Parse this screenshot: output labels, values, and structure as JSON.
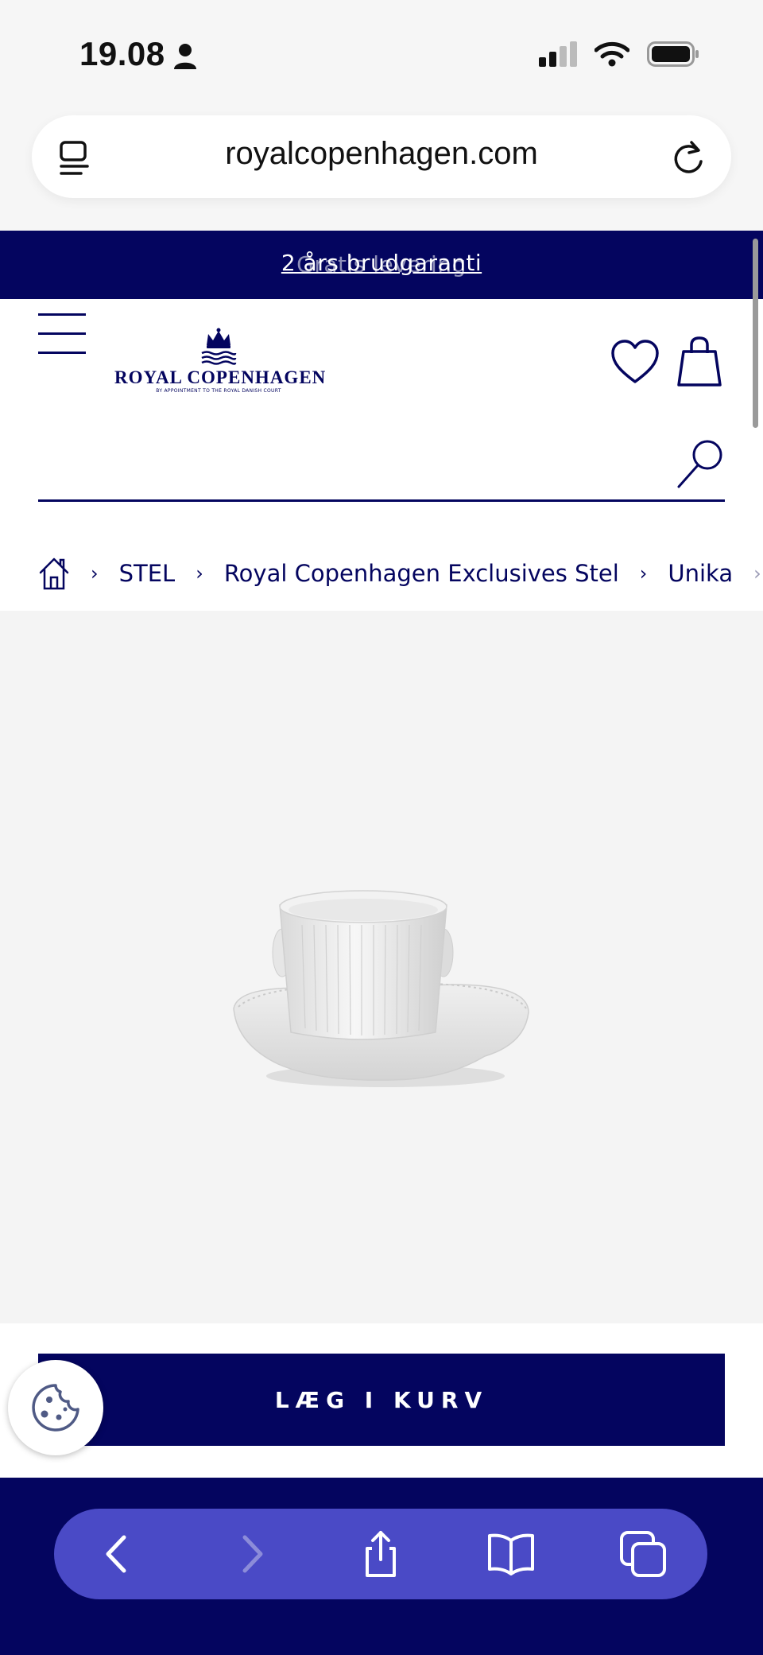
{
  "status_bar": {
    "time": "19.08"
  },
  "browser": {
    "url": "royalcopenhagen.com"
  },
  "promo": {
    "ghost_text": "Gratis levering",
    "text": "2 års brudgaranti"
  },
  "header": {
    "logo_name": "ROYAL COPENHAGEN",
    "logo_tagline": "BY APPOINTMENT TO THE ROYAL DANISH COURT"
  },
  "search": {
    "placeholder": ""
  },
  "breadcrumb": {
    "items": [
      "STEL",
      "Royal Copenhagen Exclusives Stel",
      "Unika"
    ]
  },
  "product": {
    "image_alt": "Hvid riflet kop med underkop"
  },
  "cta": {
    "label": "LÆG I KURV"
  },
  "colors": {
    "brand": "#04055f",
    "toolbar": "#4a4ac6",
    "image_bg": "#f4f4f4"
  },
  "icons": [
    "person-icon",
    "cellular-icon",
    "wifi-icon",
    "battery-icon",
    "tabs-icon",
    "reload-icon",
    "menu-icon",
    "heart-icon",
    "bag-icon",
    "search-icon",
    "home-icon",
    "cookie-icon",
    "back-icon",
    "forward-icon",
    "share-icon",
    "bookmarks-icon",
    "tabs-overview-icon"
  ]
}
